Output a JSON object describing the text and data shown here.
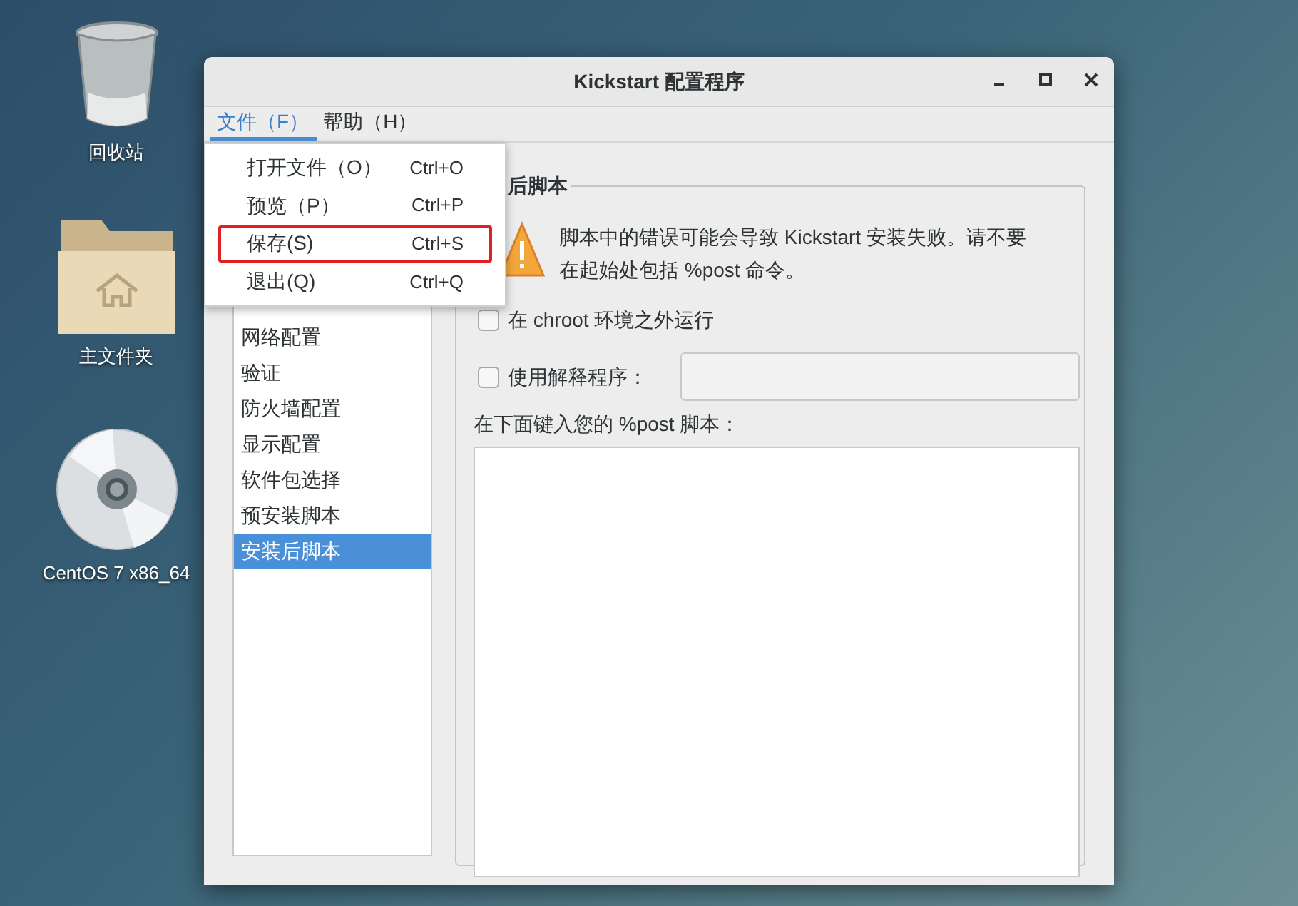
{
  "desktop_icons": [
    {
      "kind": "trash",
      "label": "回收站"
    },
    {
      "kind": "home-folder",
      "label": "主文件夹"
    },
    {
      "kind": "disc",
      "label": "CentOS 7 x86_64"
    }
  ],
  "window": {
    "title": "Kickstart 配置程序"
  },
  "menubar": [
    {
      "label": "文件（F）",
      "selected": true
    },
    {
      "label": "帮助（H）",
      "selected": false
    }
  ],
  "file_menu": [
    {
      "label": "打开文件（O）",
      "shortcut": "Ctrl+O",
      "outlined": false
    },
    {
      "label": "预览（P）",
      "shortcut": "Ctrl+P",
      "outlined": false
    },
    {
      "label": "保存(S)",
      "shortcut": "Ctrl+S",
      "outlined": true
    },
    {
      "label": "退出(Q)",
      "shortcut": "Ctrl+Q",
      "outlined": false
    }
  ],
  "sidebar": {
    "items": [
      {
        "label": "网络配置",
        "selected": false
      },
      {
        "label": "验证",
        "selected": false
      },
      {
        "label": "防火墙配置",
        "selected": false
      },
      {
        "label": "显示配置",
        "selected": false
      },
      {
        "label": "软件包选择",
        "selected": false
      },
      {
        "label": "预安装脚本",
        "selected": false
      },
      {
        "label": "安装后脚本",
        "selected": true
      }
    ]
  },
  "section": {
    "title": "后脚本",
    "warning": "脚本中的错误可能会导致 Kickstart 安装失败。请不要在起始处包括 %post 命令。",
    "options": [
      {
        "label": "在 chroot 环境之外运行",
        "checked": false
      },
      {
        "label": "使用解释程序：",
        "checked": false
      }
    ],
    "script_label": "在下面键入您的 %post 脚本："
  }
}
